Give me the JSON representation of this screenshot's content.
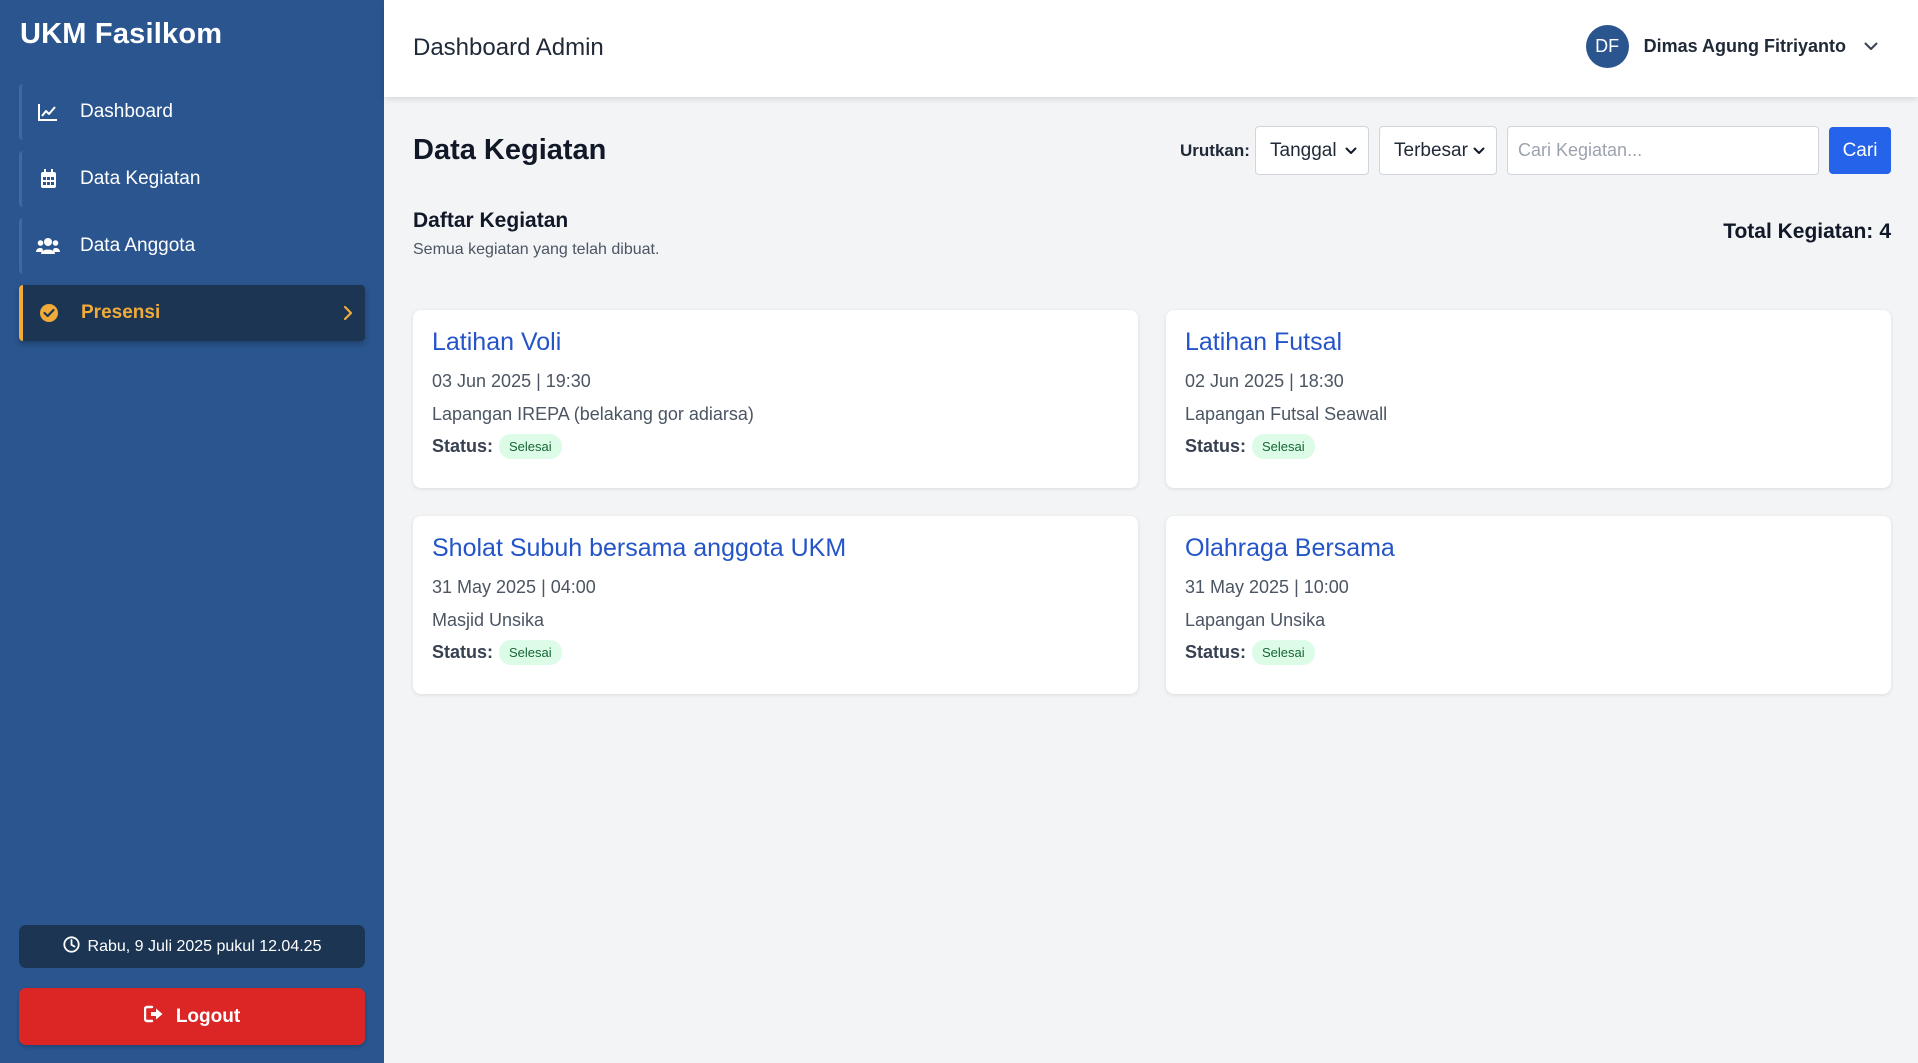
{
  "sidebar": {
    "brand": "UKM Fasilkom",
    "items": [
      {
        "label": "Dashboard",
        "icon": "chart-line-icon"
      },
      {
        "label": "Data Kegiatan",
        "icon": "calendar-icon"
      },
      {
        "label": "Data Anggota",
        "icon": "users-icon"
      },
      {
        "label": "Presensi",
        "icon": "check-circle-icon",
        "active": true
      }
    ],
    "clock": "Rabu, 9 Juli 2025 pukul 12.04.25",
    "logout_label": "Logout"
  },
  "header": {
    "title": "Dashboard Admin",
    "user_initials": "DF",
    "user_name": "Dimas Agung Fitriyanto"
  },
  "main": {
    "title": "Data Kegiatan",
    "sort_label": "Urutkan:",
    "sort_field": "Tanggal",
    "sort_order": "Terbesar",
    "search_placeholder": "Cari Kegiatan...",
    "search_button": "Cari",
    "list_title": "Daftar Kegiatan",
    "list_subtitle": "Semua kegiatan yang telah dibuat.",
    "total_label": "Total Kegiatan:",
    "total_value": "4",
    "status_label": "Status:",
    "activities": [
      {
        "title": "Latihan Voli",
        "datetime": "03 Jun 2025 | 19:30",
        "location": "Lapangan IREPA (belakang gor adiarsa)",
        "status": "Selesai"
      },
      {
        "title": "Latihan Futsal",
        "datetime": "02 Jun 2025 | 18:30",
        "location": "Lapangan Futsal Seawall",
        "status": "Selesai"
      },
      {
        "title": "Sholat Subuh bersama anggota UKM",
        "datetime": "31 May 2025 | 04:00",
        "location": "Masjid Unsika",
        "status": "Selesai"
      },
      {
        "title": "Olahraga Bersama",
        "datetime": "31 May 2025 | 10:00",
        "location": "Lapangan Unsika",
        "status": "Selesai"
      }
    ]
  },
  "colors": {
    "sidebar_bg": "#2a558f",
    "active_accent": "#f0ab3a",
    "primary_button": "#2563eb",
    "logout": "#dc2626",
    "badge_bg": "#dcfce7",
    "badge_text": "#166534"
  }
}
